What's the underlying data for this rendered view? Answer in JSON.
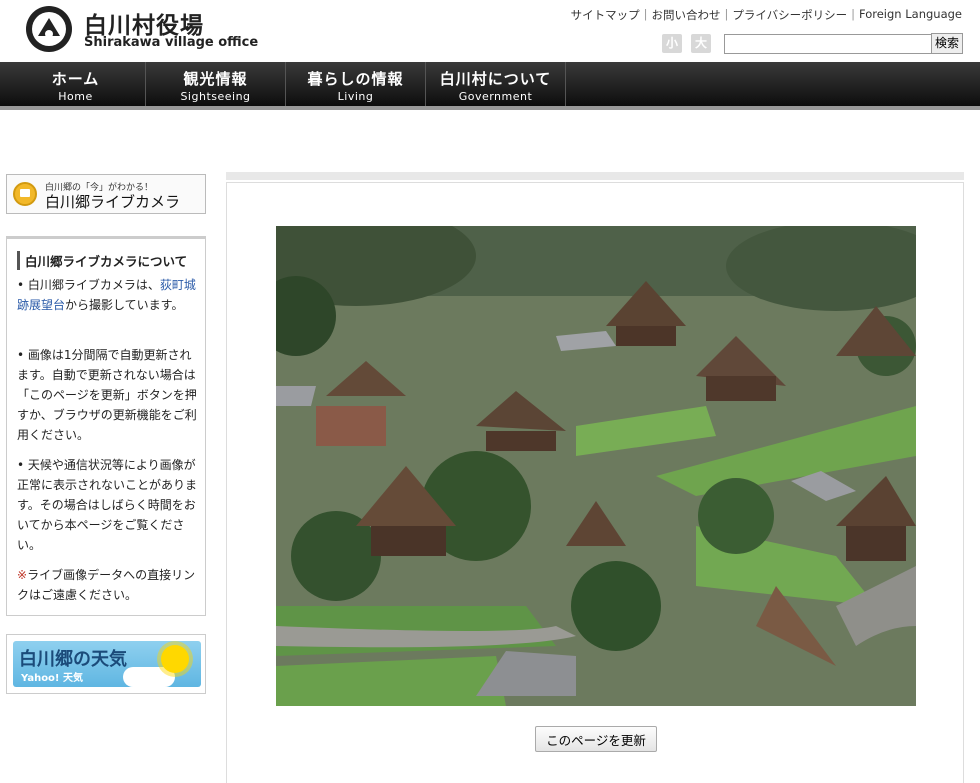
{
  "header": {
    "title": "白川村役場",
    "subtitle": "Shirakawa village office",
    "links": [
      "サイトマップ",
      "お問い合わせ",
      "プライバシーポリシー",
      "Foreign Language"
    ],
    "font_small": "小",
    "font_large": "大",
    "search_value": "",
    "search_button": "検索"
  },
  "nav": [
    {
      "jp": "ホーム",
      "en": "Home"
    },
    {
      "jp": "観光情報",
      "en": "Sightseeing"
    },
    {
      "jp": "暮らしの情報",
      "en": "Living"
    },
    {
      "jp": "白川村について",
      "en": "Government"
    }
  ],
  "sidebar": {
    "live_small": "白川郷の「今」がわかる！",
    "live_big": "白川郷ライブカメラ",
    "about_title": "白川郷ライブカメラについて",
    "p1_pre": "• 白川郷ライブカメラは、",
    "p1_link": "荻町城跡展望台",
    "p1_post": "から撮影しています。",
    "p2": "• 画像は1分間隔で自動更新されます。自動で更新されない場合は「このページを更新」ボタンを押すか、ブラウザの更新機能をご利用ください。",
    "p3": "• 天候や通信状況等により画像が正常に表示されないことがあります。その場合はしばらく時間をおいてから本ページをご覧ください。",
    "p4_mark": "※",
    "p4": "ライブ画像データへの直接リンクはご遠慮ください。",
    "weather_title": "白川郷の天気",
    "weather_sub": "Yahoo! 天気"
  },
  "main": {
    "refresh_button": "このページを更新"
  },
  "colors": {
    "nav_bg": "#1a1a1a",
    "link": "#2a5aa8",
    "note_red": "#c0392b"
  }
}
